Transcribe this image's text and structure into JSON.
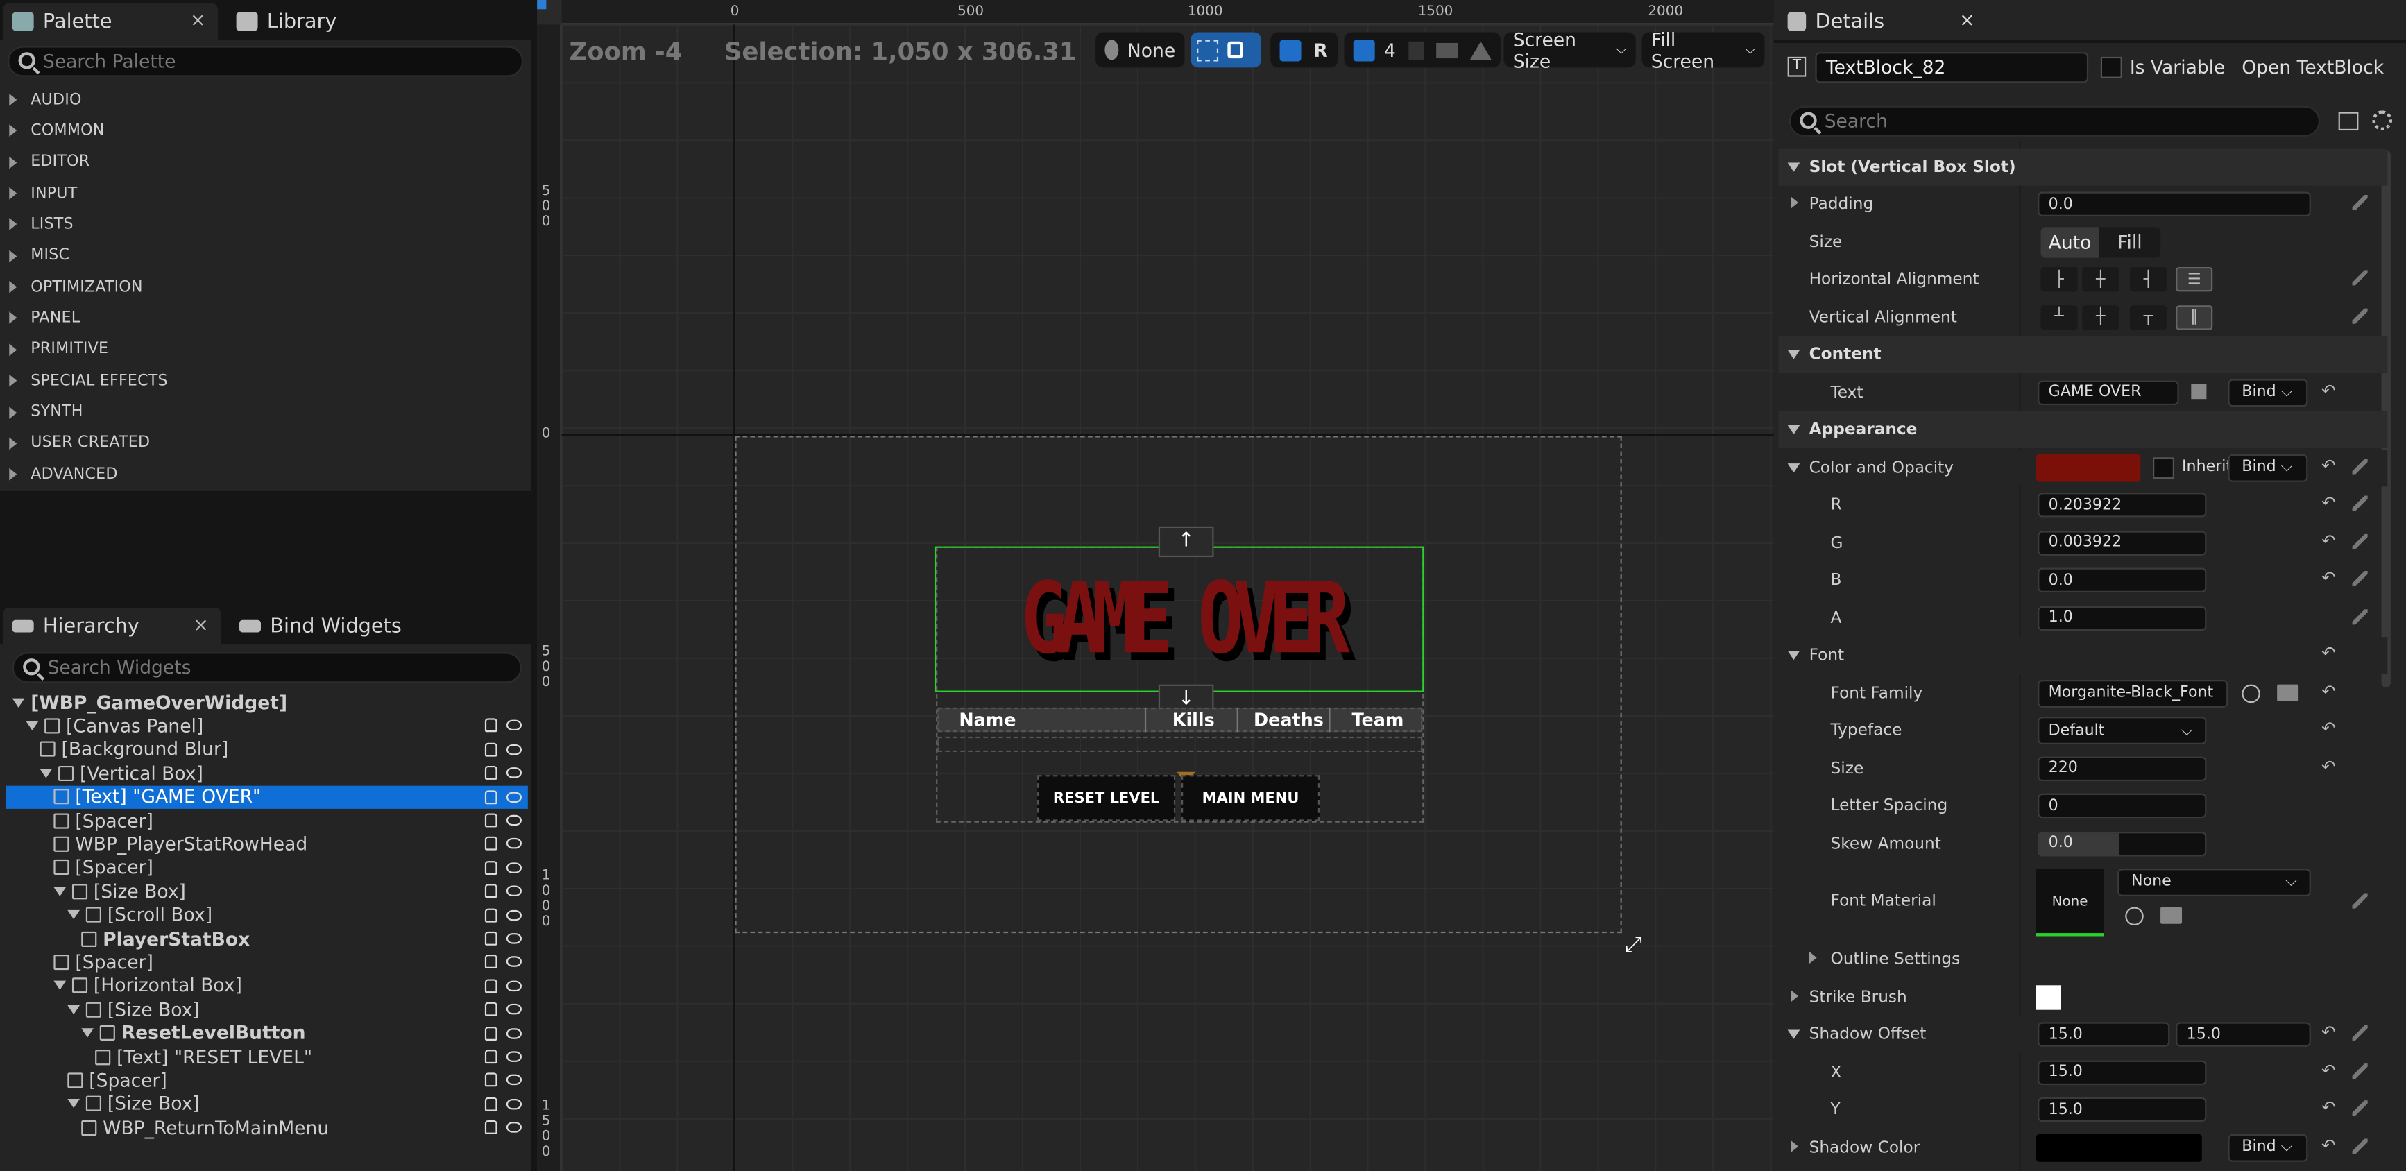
{
  "palette": {
    "tab_label": "Palette",
    "close": "×",
    "library_tab": "Library",
    "search_placeholder": "Search Palette",
    "categories": [
      "AUDIO",
      "COMMON",
      "EDITOR",
      "INPUT",
      "LISTS",
      "MISC",
      "OPTIMIZATION",
      "PANEL",
      "PRIMITIVE",
      "SPECIAL EFFECTS",
      "SYNTH",
      "USER CREATED",
      "ADVANCED"
    ]
  },
  "hierarchy": {
    "tab_label": "Hierarchy",
    "close": "×",
    "bind_tab": "Bind Widgets",
    "search_placeholder": "Search Widgets",
    "items": [
      "[WBP_GameOverWidget]",
      "[Canvas Panel]",
      "[Background Blur]",
      "[Vertical Box]",
      "[Text] \"GAME OVER\"",
      "[Spacer]",
      "WBP_PlayerStatRowHead",
      "[Spacer]",
      "[Size Box]",
      "[Scroll Box]",
      "PlayerStatBox",
      "[Spacer]",
      "[Horizontal Box]",
      "[Size Box]",
      "ResetLevelButton",
      "[Text] \"RESET LEVEL\"",
      "[Spacer]",
      "[Size Box]",
      "WBP_ReturnToMainMenu"
    ]
  },
  "viewport": {
    "zoom": "Zoom -4",
    "selection": "Selection: 1,050 x 306.31",
    "locale": "None",
    "r_label": "R",
    "grid_count": "4",
    "screen_size": "Screen Size",
    "fill_screen": "Fill Screen",
    "ruler_top": [
      "0",
      "500",
      "1000",
      "1500",
      "2000"
    ],
    "ruler_left": [
      "5\n0\n0",
      "0",
      "5\n0\n0",
      "1\n0\n0\n0",
      "1\n5\n0\n0"
    ],
    "game_over": "GAME OVER",
    "cols": [
      "Name",
      "Kills",
      "Deaths",
      "Team"
    ],
    "reset_button": "RESET LEVEL",
    "main_menu_button": "MAIN MENU",
    "game_over_color": "#7a1010"
  },
  "details": {
    "tab_label": "Details",
    "close": "×",
    "widget_name": "TextBlock_82",
    "is_variable": "Is Variable",
    "open_link": "Open TextBlock",
    "search_placeholder": "Search",
    "slot_section": "Slot (Vertical Box Slot)",
    "padding": "Padding",
    "padding_val": "0.0",
    "size": "Size",
    "size_auto": "Auto",
    "size_fill": "Fill",
    "h_align": "Horizontal Alignment",
    "v_align": "Vertical Alignment",
    "content_section": "Content",
    "text_label": "Text",
    "text_val": "GAME OVER",
    "bind": "Bind",
    "appearance_section": "Appearance",
    "color_opacity": "Color and Opacity",
    "inherit": "Inherit",
    "color_swatch": "#7a1008",
    "r": "R",
    "r_val": "0.203922",
    "g": "G",
    "g_val": "0.003922",
    "b": "B",
    "b_val": "0.0",
    "a": "A",
    "a_val": "1.0",
    "font_section": "Font",
    "font_family": "Font Family",
    "font_family_val": "Morganite-Black_Font",
    "typeface": "Typeface",
    "typeface_val": "Default",
    "font_size": "Size",
    "font_size_val": "220",
    "letter_spacing": "Letter Spacing",
    "letter_spacing_val": "0",
    "skew": "Skew Amount",
    "skew_val": "0.0",
    "font_material": "Font Material",
    "none": "None",
    "none_dd": "None",
    "outline": "Outline Settings",
    "strike": "Strike Brush",
    "shadow_offset": "Shadow Offset",
    "so_x": "15.0",
    "so_y": "15.0",
    "x": "X",
    "x_val": "15.0",
    "y": "Y",
    "y_val": "15.0",
    "shadow_color": "Shadow Color"
  }
}
